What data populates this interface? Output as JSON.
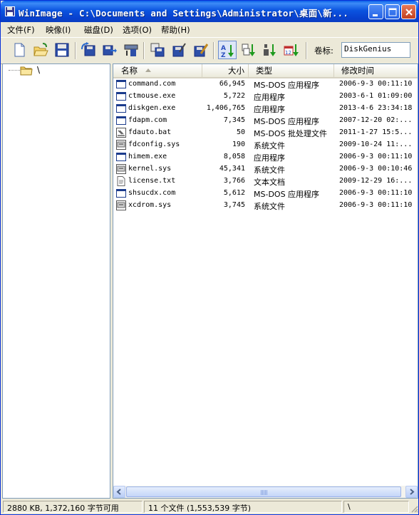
{
  "window": {
    "title": "WinImage - C:\\Documents and Settings\\Administrator\\桌面\\新...",
    "accent": "#0a5fe8"
  },
  "menu": [
    {
      "label": "文件(F)"
    },
    {
      "label": "映像(I)"
    },
    {
      "label": "磁盘(D)"
    },
    {
      "label": "选项(O)"
    },
    {
      "label": "帮助(H)"
    }
  ],
  "toolbar": {
    "buttons": [
      "new-icon",
      "open-icon",
      "save-icon",
      "inject-icon",
      "extract-icon",
      "scan-icon",
      "copy-disk-icon",
      "write-disk-icon",
      "format-disk-icon",
      "sort-name-icon",
      "sort-ext-icon",
      "sort-size-icon",
      "sort-date-icon"
    ],
    "volume_label": "卷标:",
    "volume_value": "DiskGenius"
  },
  "tree": {
    "root_label": "\\"
  },
  "list": {
    "columns": {
      "name": "名称",
      "size": "大小",
      "type": "类型",
      "modified": "修改时间"
    },
    "sort_column": "name",
    "rows": [
      {
        "name": "command.com",
        "size": "66,945",
        "type": "MS-DOS 应用程序",
        "modified": "2006-9-3   00:11:10",
        "icon": "dos-app-icon"
      },
      {
        "name": "ctmouse.exe",
        "size": "5,722",
        "type": "应用程序",
        "modified": "2003-6-1   01:09:00",
        "icon": "app-icon"
      },
      {
        "name": "diskgen.exe",
        "size": "1,406,765",
        "type": "应用程序",
        "modified": "2013-4-6   23:34:18",
        "icon": "app-icon"
      },
      {
        "name": "fdapm.com",
        "size": "7,345",
        "type": "MS-DOS 应用程序",
        "modified": "2007-12-20   02:...",
        "icon": "dos-app-icon"
      },
      {
        "name": "fdauto.bat",
        "size": "50",
        "type": "MS-DOS 批处理文件",
        "modified": "2011-1-27   15:5...",
        "icon": "batch-icon"
      },
      {
        "name": "fdconfig.sys",
        "size": "190",
        "type": "系统文件",
        "modified": "2009-10-24   11:...",
        "icon": "sys-file-icon"
      },
      {
        "name": "himem.exe",
        "size": "8,058",
        "type": "应用程序",
        "modified": "2006-9-3   00:11:10",
        "icon": "app-icon"
      },
      {
        "name": "kernel.sys",
        "size": "45,341",
        "type": "系统文件",
        "modified": "2006-9-3   00:10:46",
        "icon": "sys-file-icon"
      },
      {
        "name": "license.txt",
        "size": "3,766",
        "type": "文本文档",
        "modified": "2009-12-29   16:...",
        "icon": "text-file-icon"
      },
      {
        "name": "shsucdx.com",
        "size": "5,612",
        "type": "MS-DOS 应用程序",
        "modified": "2006-9-3   00:11:10",
        "icon": "dos-app-icon"
      },
      {
        "name": "xcdrom.sys",
        "size": "3,745",
        "type": "系统文件",
        "modified": "2006-9-3   00:11:10",
        "icon": "sys-file-icon"
      }
    ]
  },
  "status": {
    "free": "2880 KB, 1,372,160 字节可用",
    "files": "11 个文件 (1,553,539 字节)",
    "path": "\\"
  }
}
